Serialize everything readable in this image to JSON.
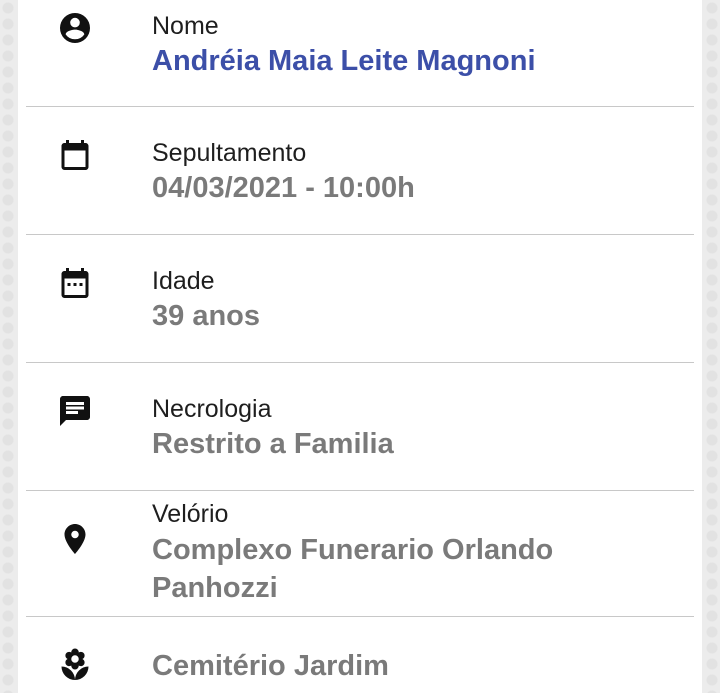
{
  "items": [
    {
      "label": "Nome",
      "value": "Andréia Maia Leite Magnoni",
      "icon": "account-circle-icon"
    },
    {
      "label": "Sepultamento",
      "value": "04/03/2021 - 10:00h",
      "icon": "calendar-icon"
    },
    {
      "label": "Idade",
      "value": "39 anos",
      "icon": "calendar-dots-icon"
    },
    {
      "label": "Necrologia",
      "value": "Restrito a Familia",
      "icon": "message-icon"
    },
    {
      "label": "Velório",
      "value_line1": "Complexo Funerario Orlando",
      "value_line2": "Panhozzi",
      "icon": "location-pin-icon"
    },
    {
      "value": "Cemitério Jardim",
      "icon": "flower-icon"
    }
  ],
  "colors": {
    "primary": "#3c4fa8",
    "value_grey": "#7a7a7a",
    "divider": "#c8c8c8"
  }
}
